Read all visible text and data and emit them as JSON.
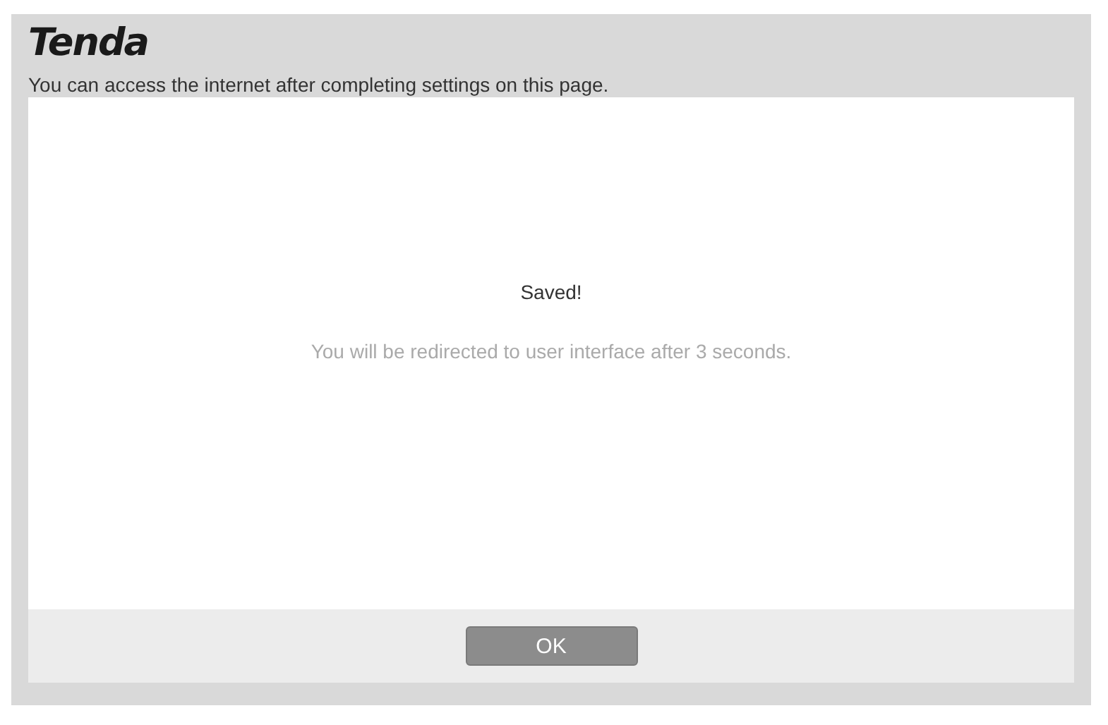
{
  "logo": "Tenda",
  "notice": "You can access the internet after completing settings on this page.",
  "message": {
    "title": "Saved!",
    "detail": "You will be redirected to user interface after 3 seconds."
  },
  "buttons": [
    "OK"
  ]
}
